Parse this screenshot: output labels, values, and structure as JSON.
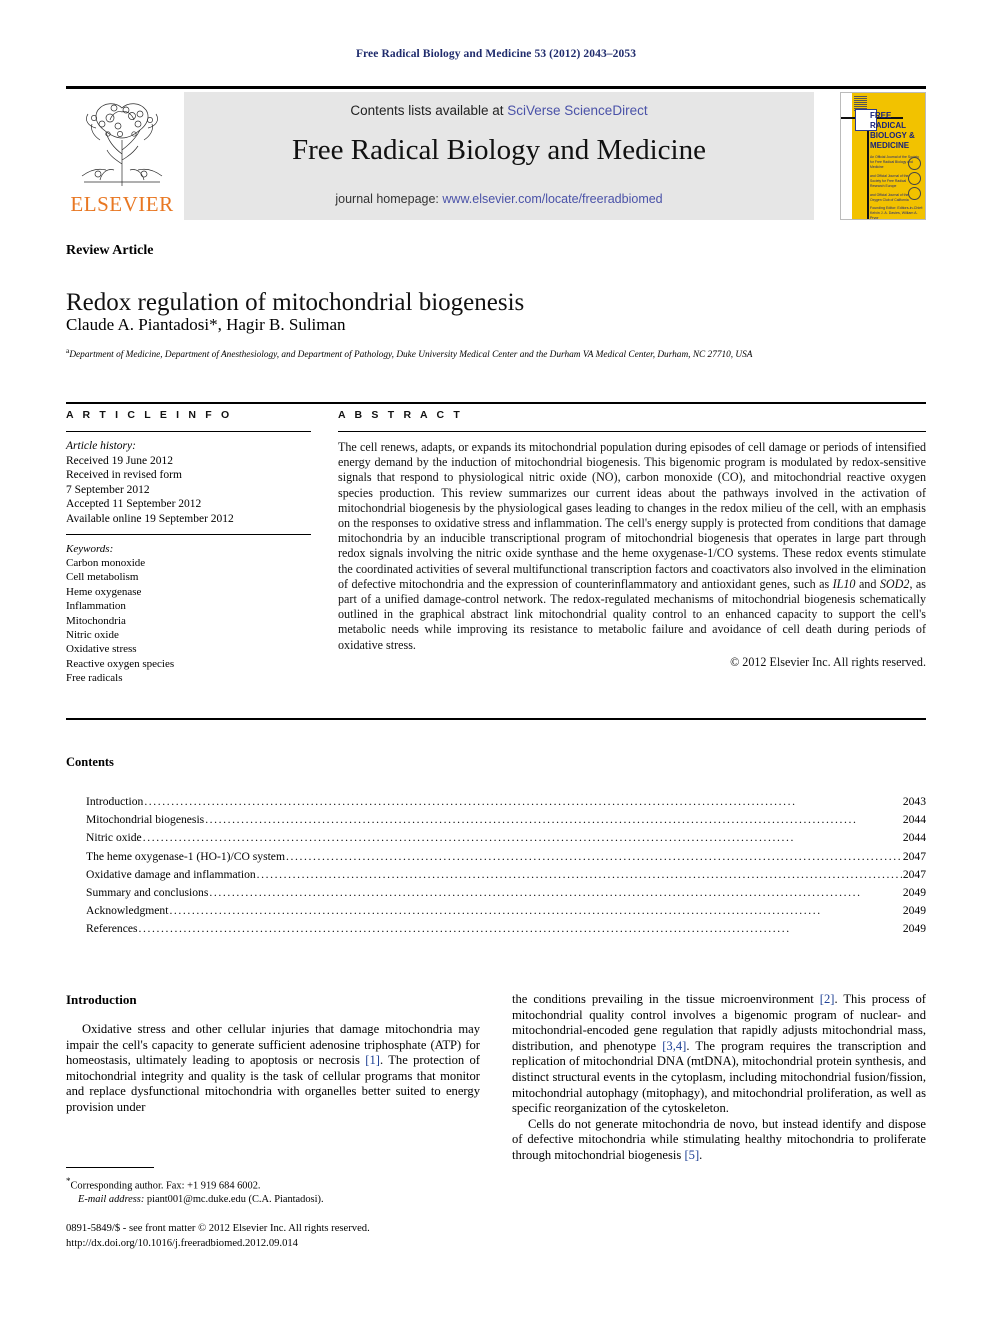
{
  "running_head": "Free Radical Biology and Medicine 53 (2012) 2043–2053",
  "masthead": {
    "contents_prefix": "Contents lists available at ",
    "contents_link": "SciVerse ScienceDirect",
    "journal_title": "Free Radical Biology and Medicine",
    "homepage_prefix": "journal homepage: ",
    "homepage_link": "www.elsevier.com/locate/freeradbiomed",
    "publisher": "ELSEVIER",
    "link_color": "#4a52a8",
    "band_color": "#e6e6e6"
  },
  "cover": {
    "title_line1": "FREE",
    "title_line2": "RADICAL",
    "title_line3": "BIOLOGY &",
    "title_line4": "MEDICINE",
    "blurb1": "An Official Journal of the Society for Free Radical Biology and Medicine",
    "blurb2": "and Official Journal of the Society for Free Radical Research Europe",
    "blurb3": "and Official Journal of the Oxygen Club of California",
    "bottom": "Founding Editor: Editors-in-Chief: Kelvin J. A. Davies, William A. Pryor",
    "background_color": "#F2C200"
  },
  "article": {
    "type": "Review Article",
    "title": "Redox regulation of mitochondrial biogenesis",
    "authors": "Claude A. Piantadosi*, Hagir B. Suliman",
    "affiliation_marker": "a",
    "affiliation": "Department of Medicine, Department of Anesthesiology, and Department of Pathology, Duke University Medical Center and the Durham VA Medical Center, Durham, NC 27710, USA"
  },
  "info": {
    "heading": "A R T I C L E   I N F O",
    "history_label": "Article history:",
    "history": [
      "Received 19 June 2012",
      "Received in revised form",
      "7 September 2012",
      "Accepted 11 September 2012",
      "Available online 19 September 2012"
    ],
    "keywords_label": "Keywords:",
    "keywords": [
      "Carbon monoxide",
      "Cell metabolism",
      "Heme oxygenase",
      "Inflammation",
      "Mitochondria",
      "Nitric oxide",
      "Oxidative stress",
      "Reactive oxygen species",
      "Free radicals"
    ]
  },
  "abstract": {
    "heading": "A B S T R A C T",
    "text_part1": "The cell renews, adapts, or expands its mitochondrial population during episodes of cell damage or periods of intensified energy demand by the induction of mitochondrial biogenesis. This bigenomic program is modulated by redox-sensitive signals that respond to physiological nitric oxide (NO), carbon monoxide (CO), and mitochondrial reactive oxygen species production. This review summarizes our current ideas about the pathways involved in the activation of mitochondrial biogenesis by the physiological gases leading to changes in the redox milieu of the cell, with an emphasis on the responses to oxidative stress and inflammation. The cell's energy supply is protected from conditions that damage mitochondria by an inducible transcriptional program of mitochondrial biogenesis that operates in large part through redox signals involving the nitric oxide synthase and the heme oxygenase-1/CO systems. These redox events stimulate the coordinated activities of several multifunctional transcription factors and coactivators also involved in the elimination of defective mitochondria and the expression of counterinflammatory and antioxidant genes, such as ",
    "italic1": "IL10",
    "text_part2": " and ",
    "italic2": "SOD2",
    "text_part3": ", as part of a unified damage-control network. The redox-regulated mechanisms of mitochondrial biogenesis schematically outlined in the graphical abstract link mitochondrial quality control to an enhanced capacity to support the cell's metabolic needs while improving its resistance to metabolic failure and avoidance of cell death during periods of oxidative stress.",
    "copyright": "© 2012 Elsevier Inc. All rights reserved."
  },
  "contents": {
    "heading": "Contents",
    "entries": [
      {
        "label": "Introduction",
        "page": "2043"
      },
      {
        "label": "Mitochondrial biogenesis",
        "page": "2044"
      },
      {
        "label": "Nitric oxide",
        "page": "2044"
      },
      {
        "label": "The heme oxygenase-1 (HO-1)/CO system",
        "page": "2047"
      },
      {
        "label": "Oxidative damage and inflammation",
        "page": "2047"
      },
      {
        "label": "Summary and conclusions",
        "page": "2049"
      },
      {
        "label": "Acknowledgment",
        "page": "2049"
      },
      {
        "label": "References",
        "page": "2049"
      }
    ]
  },
  "body": {
    "intro_heading": "Introduction",
    "left_p1_a": "Oxidative stress and other cellular injuries that damage mitochondria may impair the cell's capacity to generate sufficient adenosine triphosphate (ATP) for homeostasis, ultimately leading to apoptosis or necrosis ",
    "left_p1_ref": "[1]",
    "left_p1_b": ". The protection of mitochondrial integrity and quality is the task of cellular programs that monitor and replace dysfunctional mitochondria with organelles better suited to energy provision under",
    "right_p1_a": "the conditions prevailing in the tissue microenvironment ",
    "right_p1_ref1": "[2]",
    "right_p1_b": ". This process of mitochondrial quality control involves a bigenomic program of nuclear- and mitochondrial-encoded gene regulation that rapidly adjusts mitochondrial mass, distribution, and phenotype ",
    "right_p1_ref2": "[3,4]",
    "right_p1_c": ". The program requires the transcription and replication of mitochondrial DNA (mtDNA), mitochondrial protein synthesis, and distinct structural events in the cytoplasm, including mitochondrial fusion/fission, mitochondrial autophagy (mitophagy), and mitochondrial proliferation, as well as specific reorganization of the cytoskeleton.",
    "right_p2_a": "Cells do not generate mitochondria de novo, but instead identify and dispose of defective mitochondria while stimulating healthy mitochondria to proliferate through mitochondrial biogenesis ",
    "right_p2_ref": "[5]",
    "right_p2_b": "."
  },
  "footer": {
    "corr_star": "*",
    "corr_text": "Corresponding author. Fax: +1 919 684 6002.",
    "email_label": "E-mail address:",
    "email_value": "piant001@mc.duke.edu (C.A. Piantadosi).",
    "issn_line": "0891-5849/$ - see front matter © 2012 Elsevier Inc. All rights reserved.",
    "doi_line": "http://dx.doi.org/10.1016/j.freeradbiomed.2012.09.014"
  }
}
